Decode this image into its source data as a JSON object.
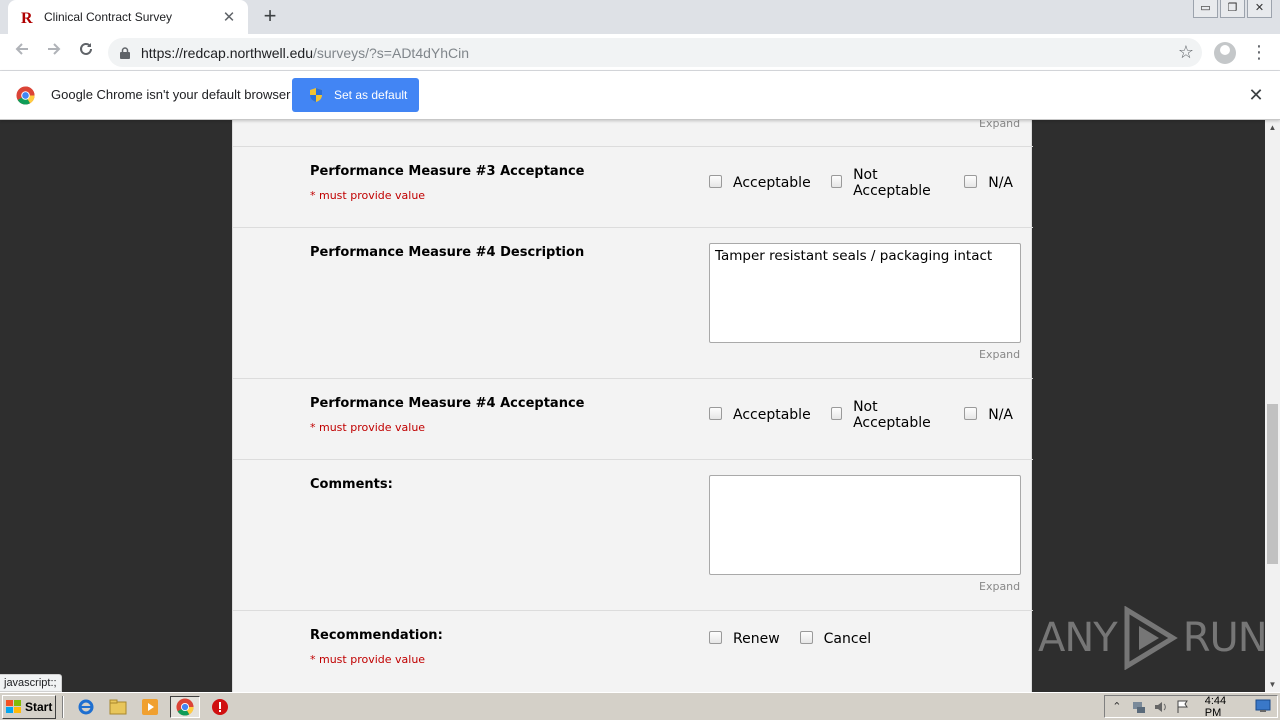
{
  "browser": {
    "tab_title": "Clinical Contract Survey",
    "tab_close": "✕",
    "new_tab": "+",
    "url_host": "https://redcap.northwell.edu",
    "url_path": "/surveys/?s=ADt4dYhCin",
    "bookmark_star": "☆",
    "menu": "⋮",
    "window_controls": [
      "▭",
      "❐",
      "✕"
    ]
  },
  "infobar": {
    "message": "Google Chrome isn't your default browser",
    "button": "Set as default",
    "close": "✕"
  },
  "form": {
    "top_expand": "Expand",
    "pm3_acceptance": {
      "label": "Performance Measure #3 Acceptance",
      "required": "* must provide value",
      "options": [
        "Acceptable",
        "Not Acceptable",
        "N/A"
      ]
    },
    "pm4_description": {
      "label": "Performance Measure #4 Description",
      "value": "Tamper resistant seals / packaging intact",
      "expand": "Expand"
    },
    "pm4_acceptance": {
      "label": "Performance Measure #4 Acceptance",
      "required": "* must provide value",
      "options": [
        "Acceptable",
        "Not Acceptable",
        "N/A"
      ]
    },
    "comments": {
      "label": "Comments:",
      "value": "",
      "expand": "Expand"
    },
    "recommendation": {
      "label": "Recommendation:",
      "required": "* must provide value",
      "options": [
        "Renew",
        "Cancel"
      ]
    }
  },
  "status_bar": "javascript:;",
  "watermark": {
    "left": "ANY",
    "right": "RUN"
  },
  "taskbar": {
    "start": "Start",
    "clock": "4:44 PM"
  },
  "colors": {
    "accent_button": "#4285f4",
    "required_text": "#c00000",
    "form_bg": "#f3f3f3",
    "page_bg": "#2e2e2e"
  }
}
